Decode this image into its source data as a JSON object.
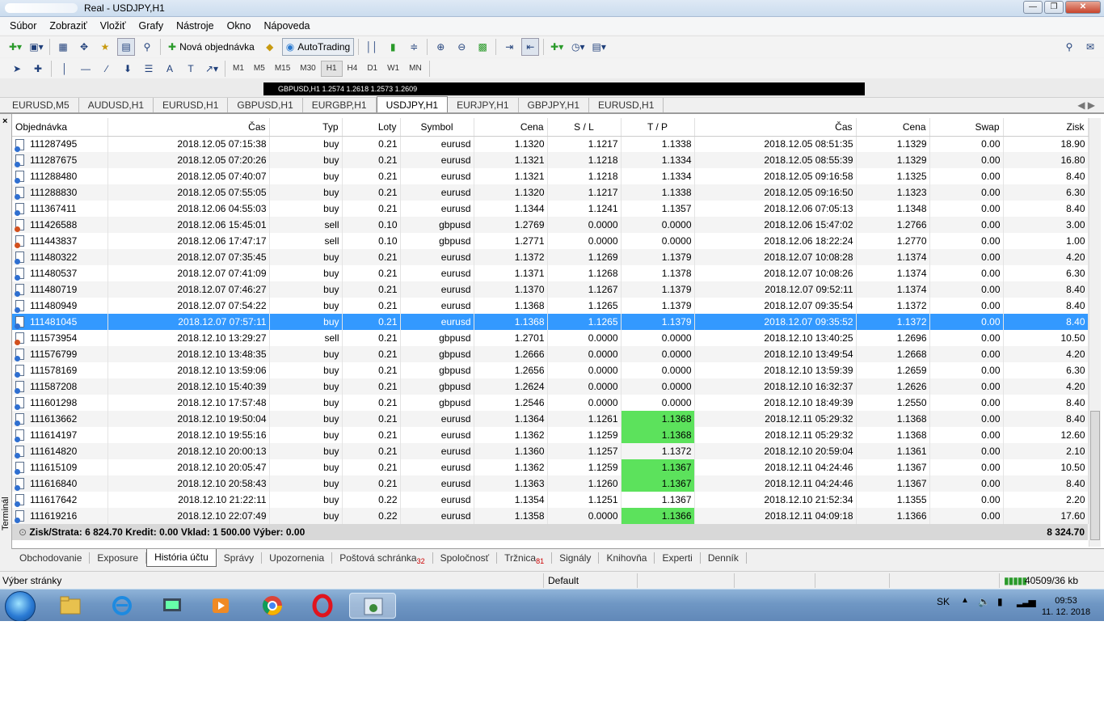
{
  "window": {
    "title": "Real - USDJPY,H1"
  },
  "menu": [
    "Súbor",
    "Zobraziť",
    "Vložiť",
    "Grafy",
    "Nástroje",
    "Okno",
    "Nápoveda"
  ],
  "toolbar": {
    "new_order": "Nová objednávka",
    "autotrading": "AutoTrading"
  },
  "timeframes": [
    "M1",
    "M5",
    "M15",
    "M30",
    "H1",
    "H4",
    "D1",
    "W1",
    "MN"
  ],
  "active_timeframe": "H1",
  "chart_strip": {
    "text": "GBPUSD,H1  1.2574 1.2618 1.2573 1.2609"
  },
  "chart_tabs": [
    "EURUSD,M5",
    "AUDUSD,H1",
    "EURUSD,H1",
    "GBPUSD,H1",
    "EURGBP,H1",
    "USDJPY,H1",
    "EURJPY,H1",
    "GBPJPY,H1",
    "EURUSD,H1"
  ],
  "active_chart_tab": "USDJPY,H1",
  "terminal": {
    "side_label": "Terminál",
    "close_glyph": "×"
  },
  "columns": [
    "Objednávka",
    "Čas",
    "Typ",
    "Loty",
    "Symbol",
    "Cena",
    "S / L",
    "T / P",
    "Čas",
    "Cena",
    "Swap",
    "Zisk"
  ],
  "rows": [
    [
      "111287495",
      "2018.12.05 07:15:38",
      "buy",
      "0.21",
      "eurusd",
      "1.1320",
      "1.1217",
      "1.1338",
      "2018.12.05 08:51:35",
      "1.1329",
      "0.00",
      "18.90"
    ],
    [
      "111287675",
      "2018.12.05 07:20:26",
      "buy",
      "0.21",
      "eurusd",
      "1.1321",
      "1.1218",
      "1.1334",
      "2018.12.05 08:55:39",
      "1.1329",
      "0.00",
      "16.80"
    ],
    [
      "111288480",
      "2018.12.05 07:40:07",
      "buy",
      "0.21",
      "eurusd",
      "1.1321",
      "1.1218",
      "1.1334",
      "2018.12.05 09:16:58",
      "1.1325",
      "0.00",
      "8.40"
    ],
    [
      "111288830",
      "2018.12.05 07:55:05",
      "buy",
      "0.21",
      "eurusd",
      "1.1320",
      "1.1217",
      "1.1338",
      "2018.12.05 09:16:50",
      "1.1323",
      "0.00",
      "6.30"
    ],
    [
      "111367411",
      "2018.12.06 04:55:03",
      "buy",
      "0.21",
      "eurusd",
      "1.1344",
      "1.1241",
      "1.1357",
      "2018.12.06 07:05:13",
      "1.1348",
      "0.00",
      "8.40"
    ],
    [
      "111426588",
      "2018.12.06 15:45:01",
      "sell",
      "0.10",
      "gbpusd",
      "1.2769",
      "0.0000",
      "0.0000",
      "2018.12.06 15:47:02",
      "1.2766",
      "0.00",
      "3.00"
    ],
    [
      "111443837",
      "2018.12.06 17:47:17",
      "sell",
      "0.10",
      "gbpusd",
      "1.2771",
      "0.0000",
      "0.0000",
      "2018.12.06 18:22:24",
      "1.2770",
      "0.00",
      "1.00"
    ],
    [
      "111480322",
      "2018.12.07 07:35:45",
      "buy",
      "0.21",
      "eurusd",
      "1.1372",
      "1.1269",
      "1.1379",
      "2018.12.07 10:08:28",
      "1.1374",
      "0.00",
      "4.20"
    ],
    [
      "111480537",
      "2018.12.07 07:41:09",
      "buy",
      "0.21",
      "eurusd",
      "1.1371",
      "1.1268",
      "1.1378",
      "2018.12.07 10:08:26",
      "1.1374",
      "0.00",
      "6.30"
    ],
    [
      "111480719",
      "2018.12.07 07:46:27",
      "buy",
      "0.21",
      "eurusd",
      "1.1370",
      "1.1267",
      "1.1379",
      "2018.12.07 09:52:11",
      "1.1374",
      "0.00",
      "8.40"
    ],
    [
      "111480949",
      "2018.12.07 07:54:22",
      "buy",
      "0.21",
      "eurusd",
      "1.1368",
      "1.1265",
      "1.1379",
      "2018.12.07 09:35:54",
      "1.1372",
      "0.00",
      "8.40"
    ],
    [
      "111481045",
      "2018.12.07 07:57:11",
      "buy",
      "0.21",
      "eurusd",
      "1.1368",
      "1.1265",
      "1.1379",
      "2018.12.07 09:35:52",
      "1.1372",
      "0.00",
      "8.40"
    ],
    [
      "111573954",
      "2018.12.10 13:29:27",
      "sell",
      "0.21",
      "gbpusd",
      "1.2701",
      "0.0000",
      "0.0000",
      "2018.12.10 13:40:25",
      "1.2696",
      "0.00",
      "10.50"
    ],
    [
      "111576799",
      "2018.12.10 13:48:35",
      "buy",
      "0.21",
      "gbpusd",
      "1.2666",
      "0.0000",
      "0.0000",
      "2018.12.10 13:49:54",
      "1.2668",
      "0.00",
      "4.20"
    ],
    [
      "111578169",
      "2018.12.10 13:59:06",
      "buy",
      "0.21",
      "gbpusd",
      "1.2656",
      "0.0000",
      "0.0000",
      "2018.12.10 13:59:39",
      "1.2659",
      "0.00",
      "6.30"
    ],
    [
      "111587208",
      "2018.12.10 15:40:39",
      "buy",
      "0.21",
      "gbpusd",
      "1.2624",
      "0.0000",
      "0.0000",
      "2018.12.10 16:32:37",
      "1.2626",
      "0.00",
      "4.20"
    ],
    [
      "111601298",
      "2018.12.10 17:57:48",
      "buy",
      "0.21",
      "gbpusd",
      "1.2546",
      "0.0000",
      "0.0000",
      "2018.12.10 18:49:39",
      "1.2550",
      "0.00",
      "8.40"
    ],
    [
      "111613662",
      "2018.12.10 19:50:04",
      "buy",
      "0.21",
      "eurusd",
      "1.1364",
      "1.1261",
      "1.1368",
      "2018.12.11 05:29:32",
      "1.1368",
      "0.00",
      "8.40"
    ],
    [
      "111614197",
      "2018.12.10 19:55:16",
      "buy",
      "0.21",
      "eurusd",
      "1.1362",
      "1.1259",
      "1.1368",
      "2018.12.11 05:29:32",
      "1.1368",
      "0.00",
      "12.60"
    ],
    [
      "111614820",
      "2018.12.10 20:00:13",
      "buy",
      "0.21",
      "eurusd",
      "1.1360",
      "1.1257",
      "1.1372",
      "2018.12.10 20:59:04",
      "1.1361",
      "0.00",
      "2.10"
    ],
    [
      "111615109",
      "2018.12.10 20:05:47",
      "buy",
      "0.21",
      "eurusd",
      "1.1362",
      "1.1259",
      "1.1367",
      "2018.12.11 04:24:46",
      "1.1367",
      "0.00",
      "10.50"
    ],
    [
      "111616840",
      "2018.12.10 20:58:43",
      "buy",
      "0.21",
      "eurusd",
      "1.1363",
      "1.1260",
      "1.1367",
      "2018.12.11 04:24:46",
      "1.1367",
      "0.00",
      "8.40"
    ],
    [
      "111617642",
      "2018.12.10 21:22:11",
      "buy",
      "0.22",
      "eurusd",
      "1.1354",
      "1.1251",
      "1.1367",
      "2018.12.10 21:52:34",
      "1.1355",
      "0.00",
      "2.20"
    ],
    [
      "111619216",
      "2018.12.10 22:07:49",
      "buy",
      "0.22",
      "eurusd",
      "1.1358",
      "0.0000",
      "1.1366",
      "2018.12.11 04:09:18",
      "1.1366",
      "0.00",
      "17.60"
    ]
  ],
  "selected_row": 11,
  "tp_highlight_rows": [
    17,
    18,
    20,
    21,
    23
  ],
  "highlight_color": "#5ce25c",
  "selection_color": "#3399ff",
  "summary": {
    "text": "Zisk/Strata: 6 824.70  Kredit: 0.00  Vklad: 1 500.00  Výber: 0.00",
    "total": "8 324.70"
  },
  "bottom_tabs": [
    {
      "label": "Obchodovanie"
    },
    {
      "label": "Exposure"
    },
    {
      "label": "História účtu",
      "active": true
    },
    {
      "label": "Správy"
    },
    {
      "label": "Upozornenia"
    },
    {
      "label": "Poštová schránka",
      "badge": "32"
    },
    {
      "label": "Spoločnosť"
    },
    {
      "label": "Tržnica",
      "badge": "81"
    },
    {
      "label": "Signály"
    },
    {
      "label": "Knihovňa"
    },
    {
      "label": "Experti"
    },
    {
      "label": "Denník"
    }
  ],
  "statusbar": {
    "left": "Výber stránky",
    "profile": "Default",
    "traffic": "40509/36 kb"
  },
  "taskbar": {
    "lang": "SK",
    "time": "09:53",
    "date": "11. 12. 2018"
  }
}
